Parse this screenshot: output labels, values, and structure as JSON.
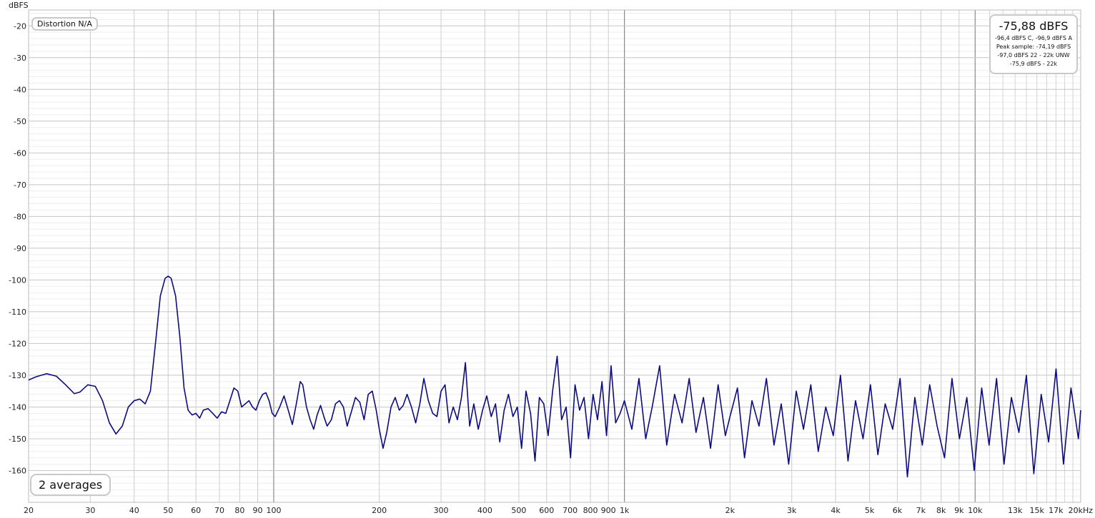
{
  "chart_data": {
    "type": "line",
    "ylabel": "dBFS",
    "xlabel_unit": "kHz",
    "x_scale": "log",
    "xlim": [
      20,
      20000
    ],
    "ylim": [
      -170,
      -15
    ],
    "x_tick_labels": [
      {
        "value": 20,
        "label": "20"
      },
      {
        "value": 30,
        "label": "30"
      },
      {
        "value": 40,
        "label": "40"
      },
      {
        "value": 50,
        "label": "50"
      },
      {
        "value": 60,
        "label": "60"
      },
      {
        "value": 70,
        "label": "70"
      },
      {
        "value": 80,
        "label": "80"
      },
      {
        "value": 90,
        "label": "90"
      },
      {
        "value": 100,
        "label": "100"
      },
      {
        "value": 200,
        "label": "200"
      },
      {
        "value": 300,
        "label": "300"
      },
      {
        "value": 400,
        "label": "400"
      },
      {
        "value": 500,
        "label": "500"
      },
      {
        "value": 600,
        "label": "600"
      },
      {
        "value": 700,
        "label": "700"
      },
      {
        "value": 800,
        "label": "800"
      },
      {
        "value": 900,
        "label": "900"
      },
      {
        "value": 1000,
        "label": "1k"
      },
      {
        "value": 2000,
        "label": "2k"
      },
      {
        "value": 3000,
        "label": "3k"
      },
      {
        "value": 4000,
        "label": "4k"
      },
      {
        "value": 5000,
        "label": "5k"
      },
      {
        "value": 6000,
        "label": "6k"
      },
      {
        "value": 7000,
        "label": "7k"
      },
      {
        "value": 8000,
        "label": "8k"
      },
      {
        "value": 9000,
        "label": "9k"
      },
      {
        "value": 10000,
        "label": "10k"
      },
      {
        "value": 13000,
        "label": "13k"
      },
      {
        "value": 15000,
        "label": "15k"
      },
      {
        "value": 17000,
        "label": "17k"
      },
      {
        "value": 20000,
        "label": "20kHz"
      }
    ],
    "y_ticks": [
      -20,
      -30,
      -40,
      -50,
      -60,
      -70,
      -80,
      -90,
      -100,
      -110,
      -120,
      -130,
      -140,
      -150,
      -160
    ],
    "grid": true,
    "series": [
      {
        "color": "#0c0c80",
        "points": [
          [
            20,
            -131.5
          ],
          [
            21,
            -130.5
          ],
          [
            22.5,
            -129.5
          ],
          [
            24,
            -130.3
          ],
          [
            25.5,
            -133
          ],
          [
            27,
            -135.8
          ],
          [
            28,
            -135.3
          ],
          [
            29.5,
            -133
          ],
          [
            31,
            -133.5
          ],
          [
            32.5,
            -138
          ],
          [
            34,
            -145
          ],
          [
            35.5,
            -148.5
          ],
          [
            37,
            -146
          ],
          [
            38.5,
            -140
          ],
          [
            40,
            -138
          ],
          [
            41.5,
            -137.5
          ],
          [
            43,
            -139
          ],
          [
            44.5,
            -135
          ],
          [
            46,
            -120
          ],
          [
            47.5,
            -105
          ],
          [
            49,
            -99.5
          ],
          [
            50,
            -98.8
          ],
          [
            51,
            -99.5
          ],
          [
            52.5,
            -105
          ],
          [
            54,
            -118
          ],
          [
            55.5,
            -134
          ],
          [
            57,
            -141
          ],
          [
            58.5,
            -142.5
          ],
          [
            60,
            -142
          ],
          [
            61.5,
            -143.5
          ],
          [
            63,
            -141
          ],
          [
            65,
            -140.5
          ],
          [
            67,
            -142
          ],
          [
            69,
            -143.5
          ],
          [
            71,
            -141.5
          ],
          [
            73,
            -142
          ],
          [
            75,
            -138
          ],
          [
            77,
            -134
          ],
          [
            79,
            -135
          ],
          [
            81,
            -140
          ],
          [
            83,
            -139
          ],
          [
            85,
            -138
          ],
          [
            87,
            -140
          ],
          [
            89,
            -141
          ],
          [
            91,
            -138
          ],
          [
            93,
            -136
          ],
          [
            95,
            -135.5
          ],
          [
            97,
            -138
          ],
          [
            99,
            -142
          ],
          [
            101,
            -143
          ],
          [
            104,
            -140
          ],
          [
            107,
            -136.5
          ],
          [
            110,
            -141
          ],
          [
            113,
            -145.5
          ],
          [
            116,
            -139
          ],
          [
            119,
            -132
          ],
          [
            121,
            -133
          ],
          [
            124,
            -140
          ],
          [
            127,
            -144
          ],
          [
            130,
            -147
          ],
          [
            133,
            -142.5
          ],
          [
            136,
            -139.5
          ],
          [
            139,
            -143
          ],
          [
            142,
            -146
          ],
          [
            146,
            -144
          ],
          [
            150,
            -139
          ],
          [
            154,
            -138
          ],
          [
            158,
            -140
          ],
          [
            162,
            -146
          ],
          [
            167,
            -141
          ],
          [
            171,
            -137
          ],
          [
            176,
            -138.5
          ],
          [
            181,
            -144
          ],
          [
            186,
            -136
          ],
          [
            191,
            -135
          ],
          [
            196,
            -141
          ],
          [
            200,
            -147
          ],
          [
            205,
            -153
          ],
          [
            210,
            -148
          ],
          [
            216,
            -140
          ],
          [
            222,
            -137
          ],
          [
            228,
            -141
          ],
          [
            234,
            -139.5
          ],
          [
            240,
            -136
          ],
          [
            247,
            -140
          ],
          [
            254,
            -145
          ],
          [
            261,
            -139
          ],
          [
            268,
            -131
          ],
          [
            276,
            -138
          ],
          [
            284,
            -142
          ],
          [
            292,
            -143
          ],
          [
            300,
            -135
          ],
          [
            308,
            -133
          ],
          [
            316,
            -145
          ],
          [
            325,
            -140
          ],
          [
            334,
            -144
          ],
          [
            343,
            -137
          ],
          [
            352,
            -126
          ],
          [
            362,
            -146
          ],
          [
            372,
            -139
          ],
          [
            383,
            -147
          ],
          [
            394,
            -141
          ],
          [
            405,
            -136.5
          ],
          [
            417,
            -143
          ],
          [
            429,
            -139
          ],
          [
            441,
            -151
          ],
          [
            454,
            -141
          ],
          [
            467,
            -136
          ],
          [
            481,
            -143
          ],
          [
            495,
            -140
          ],
          [
            509,
            -153
          ],
          [
            524,
            -135
          ],
          [
            540,
            -142
          ],
          [
            556,
            -157
          ],
          [
            572,
            -137
          ],
          [
            589,
            -139
          ],
          [
            606,
            -149
          ],
          [
            624,
            -135
          ],
          [
            643,
            -124
          ],
          [
            662,
            -144
          ],
          [
            682,
            -140
          ],
          [
            702,
            -156
          ],
          [
            723,
            -133
          ],
          [
            745,
            -141
          ],
          [
            767,
            -137
          ],
          [
            790,
            -150
          ],
          [
            814,
            -136
          ],
          [
            838,
            -144
          ],
          [
            863,
            -132
          ],
          [
            889,
            -149
          ],
          [
            916,
            -127
          ],
          [
            944,
            -145
          ],
          [
            972,
            -142
          ],
          [
            1000,
            -138
          ],
          [
            1050,
            -147
          ],
          [
            1100,
            -131
          ],
          [
            1150,
            -150
          ],
          [
            1200,
            -140
          ],
          [
            1260,
            -127
          ],
          [
            1320,
            -152
          ],
          [
            1390,
            -136
          ],
          [
            1460,
            -145
          ],
          [
            1530,
            -131
          ],
          [
            1600,
            -148
          ],
          [
            1680,
            -137
          ],
          [
            1760,
            -153
          ],
          [
            1850,
            -133
          ],
          [
            1940,
            -149
          ],
          [
            2000,
            -143
          ],
          [
            2100,
            -134
          ],
          [
            2200,
            -156
          ],
          [
            2310,
            -138
          ],
          [
            2420,
            -146
          ],
          [
            2540,
            -131
          ],
          [
            2670,
            -152
          ],
          [
            2800,
            -139
          ],
          [
            2940,
            -158
          ],
          [
            3090,
            -135
          ],
          [
            3240,
            -147
          ],
          [
            3400,
            -133
          ],
          [
            3570,
            -154
          ],
          [
            3750,
            -140
          ],
          [
            3940,
            -149
          ],
          [
            4130,
            -130
          ],
          [
            4340,
            -157
          ],
          [
            4560,
            -138
          ],
          [
            4790,
            -150
          ],
          [
            5030,
            -133
          ],
          [
            5280,
            -155
          ],
          [
            5540,
            -139
          ],
          [
            5820,
            -147
          ],
          [
            6110,
            -131
          ],
          [
            6410,
            -162
          ],
          [
            6730,
            -137
          ],
          [
            7070,
            -152
          ],
          [
            7420,
            -133
          ],
          [
            7790,
            -146
          ],
          [
            8180,
            -156
          ],
          [
            8590,
            -131
          ],
          [
            9020,
            -150
          ],
          [
            9470,
            -137
          ],
          [
            9940,
            -160
          ],
          [
            10440,
            -134
          ],
          [
            10960,
            -152
          ],
          [
            11510,
            -131
          ],
          [
            12090,
            -158
          ],
          [
            12690,
            -137
          ],
          [
            13330,
            -148
          ],
          [
            14000,
            -130
          ],
          [
            14700,
            -161
          ],
          [
            15430,
            -136
          ],
          [
            16200,
            -151
          ],
          [
            17010,
            -128
          ],
          [
            17860,
            -158
          ],
          [
            18760,
            -134
          ],
          [
            19700,
            -150
          ],
          [
            20000,
            -141
          ]
        ]
      }
    ]
  },
  "overlays": {
    "distortion": "Distortion N/A",
    "averages": "2 averages",
    "level_main": "-75,88 dBFS",
    "level_lines": [
      "-96,4 dBFS C, -96,9 dBFS A",
      "Peak sample: -74,19 dBFS",
      "-97,0 dBFS 22 - 22k UNW",
      "-75,9 dBFS - 22k"
    ]
  }
}
